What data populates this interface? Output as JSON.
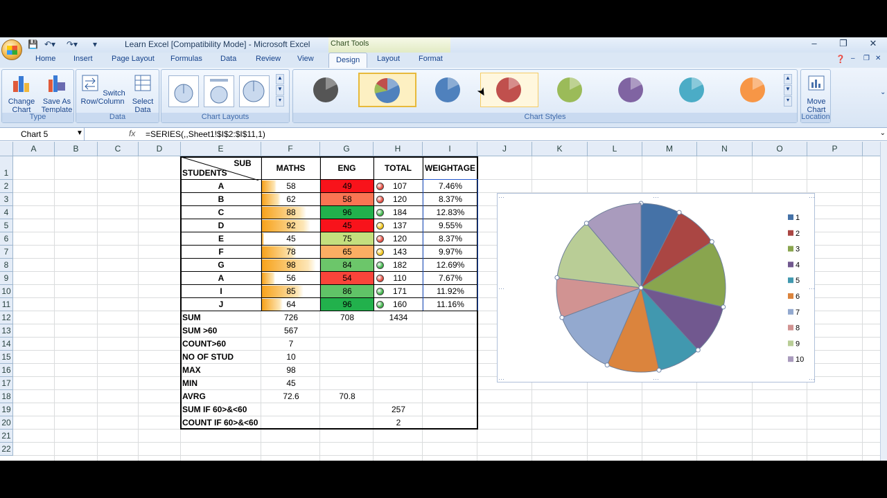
{
  "window": {
    "title": "Learn Excel  [Compatibility Mode] - Microsoft Excel",
    "context_tab": "Chart Tools",
    "controls": [
      "–",
      "❐",
      "✕"
    ]
  },
  "ribbon_tabs": [
    {
      "label": "Home"
    },
    {
      "label": "Insert"
    },
    {
      "label": "Page Layout"
    },
    {
      "label": "Formulas"
    },
    {
      "label": "Data"
    },
    {
      "label": "Review"
    },
    {
      "label": "View"
    },
    {
      "label": "Design",
      "active": true
    },
    {
      "label": "Layout"
    },
    {
      "label": "Format"
    }
  ],
  "groups": {
    "type": {
      "label": "Type",
      "change_chart_type": "Change Chart Type",
      "save_as_template": "Save As Template"
    },
    "data": {
      "label": "Data",
      "switch_row_column": "Switch Row/Column",
      "select_data": "Select Data"
    },
    "chart_layouts": {
      "label": "Chart Layouts"
    },
    "chart_styles": {
      "label": "Chart Styles"
    },
    "location": {
      "label": "Location",
      "move_chart": "Move Chart"
    }
  },
  "formula_bar": {
    "name_box": "Chart 5",
    "fx": "fx",
    "formula": "=SERIES(,,Sheet1!$I$2:$I$11,1)"
  },
  "columns": [
    "A",
    "B",
    "C",
    "D",
    "E",
    "F",
    "G",
    "H",
    "I",
    "J",
    "K",
    "L",
    "M",
    "N",
    "O",
    "P"
  ],
  "rows": [
    "1",
    "2",
    "3",
    "4",
    "5",
    "6",
    "7",
    "8",
    "9",
    "10",
    "11",
    "12",
    "13",
    "14",
    "15",
    "16",
    "17",
    "18",
    "19",
    "20",
    "21",
    "22"
  ],
  "table": {
    "header": {
      "sub": "SUB",
      "students": "STUDENTS",
      "maths": "MATHS",
      "eng": "ENG",
      "total": "TOTAL",
      "weightage": "WEIGHTAGE"
    },
    "students": [
      {
        "name": "A",
        "maths": "58",
        "eng": "49",
        "total": "107",
        "weightage": "7.46%",
        "eng_color": "#f8131b",
        "dot": "#e34b3f"
      },
      {
        "name": "B",
        "maths": "62",
        "eng": "58",
        "total": "120",
        "weightage": "8.37%",
        "eng_color": "#fa7453",
        "dot": "#e34b3f"
      },
      {
        "name": "C",
        "maths": "88",
        "eng": "96",
        "total": "184",
        "weightage": "12.83%",
        "eng_color": "#22b14c",
        "dot": "#3fb34a"
      },
      {
        "name": "D",
        "maths": "92",
        "eng": "45",
        "total": "137",
        "weightage": "9.55%",
        "eng_color": "#f8131b",
        "dot": "#f0c419"
      },
      {
        "name": "E",
        "maths": "45",
        "eng": "75",
        "total": "120",
        "weightage": "8.37%",
        "eng_color": "#c4df7e",
        "dot": "#e34b3f"
      },
      {
        "name": "F",
        "maths": "78",
        "eng": "65",
        "total": "143",
        "weightage": "9.97%",
        "eng_color": "#fbae63",
        "dot": "#f0c419"
      },
      {
        "name": "G",
        "maths": "98",
        "eng": "84",
        "total": "182",
        "weightage": "12.69%",
        "eng_color": "#6cc66a",
        "dot": "#3fb34a"
      },
      {
        "name": "A",
        "maths": "56",
        "eng": "54",
        "total": "110",
        "weightage": "7.67%",
        "eng_color": "#f9443a",
        "dot": "#e34b3f"
      },
      {
        "name": "I",
        "maths": "85",
        "eng": "86",
        "total": "171",
        "weightage": "11.92%",
        "eng_color": "#60c367",
        "dot": "#3fb34a"
      },
      {
        "name": "J",
        "maths": "64",
        "eng": "96",
        "total": "160",
        "weightage": "11.16%",
        "eng_color": "#22b14c",
        "dot": "#3fb34a"
      }
    ],
    "stats": [
      {
        "label": "SUM",
        "f": "726",
        "g": "708",
        "h": "1434"
      },
      {
        "label": "SUM >60",
        "f": "567",
        "g": "",
        "h": ""
      },
      {
        "label": "COUNT>60",
        "f": "7",
        "g": "",
        "h": ""
      },
      {
        "label": "NO OF STUD",
        "f": "10",
        "g": "",
        "h": ""
      },
      {
        "label": "MAX",
        "f": "98",
        "g": "",
        "h": ""
      },
      {
        "label": "MIN",
        "f": "45",
        "g": "",
        "h": ""
      },
      {
        "label": "AVRG",
        "f": "72.6",
        "g": "70.8",
        "h": ""
      },
      {
        "label": "SUM IF 60>&<60",
        "f": "",
        "g": "",
        "h": "257"
      },
      {
        "label": "COUNT IF 60>&<60",
        "f": "",
        "g": "",
        "h": "2"
      }
    ]
  },
  "chart_data": {
    "type": "pie",
    "categories": [
      "1",
      "2",
      "3",
      "4",
      "5",
      "6",
      "7",
      "8",
      "9",
      "10"
    ],
    "values": [
      7.46,
      8.37,
      12.83,
      9.55,
      8.37,
      9.97,
      12.69,
      7.67,
      11.92,
      11.16
    ],
    "colors": [
      "#4572a7",
      "#aa4643",
      "#89a54e",
      "#71588f",
      "#4198af",
      "#db843d",
      "#93a9cf",
      "#d19392",
      "#b9cd96",
      "#a99bbd"
    ],
    "legend": "right",
    "title": ""
  },
  "style_colors": [
    "#555555",
    "#4f81bd",
    "#4f81bd",
    "#c0504d",
    "#9bbb59",
    "#8064a2",
    "#4bacc6",
    "#f79646"
  ]
}
